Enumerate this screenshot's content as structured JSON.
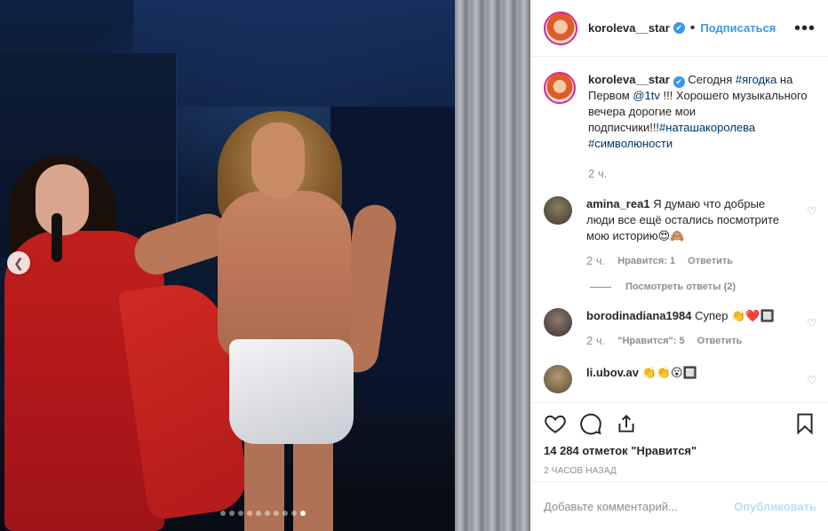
{
  "post": {
    "username": "koroleva__star",
    "follow_label": "Подписаться",
    "more_label": "•••"
  },
  "caption": {
    "username": "koroleva__star",
    "text_before": "Сегодня ",
    "tag1": "#ягодка",
    "text_mid1": " на Первом ",
    "tag2": "@1tv",
    "text_mid2": " !!! Хорошего музыкального вечера дорогие мои подписчики!!!",
    "tag3": "#наташакоролева",
    "tag4": "#символюности",
    "time": "2 ч."
  },
  "comments": [
    {
      "username": "amina_rea1",
      "text": "Я думаю что добрые люди все ещё остались посмотрите мою историю😍🙈",
      "time": "2 ч.",
      "likes": "Нравится: 1",
      "reply": "Ответить",
      "view_replies": "Посмотреть ответы (2)"
    },
    {
      "username": "borodinadiana1984",
      "text": "Супер 👏❤️🔲",
      "time": "2 ч.",
      "likes": "\"Нравится\": 5",
      "reply": "Ответить"
    },
    {
      "username": "li.ubov.av",
      "text": "👏👏😮🔲"
    }
  ],
  "stats": {
    "likes": "14 284 отметок \"Нравится\"",
    "ago": "2 ЧАСОВ НАЗАД"
  },
  "composer": {
    "placeholder": "Добавьте комментарий...",
    "publish": "Опубликовать"
  },
  "carousel": {
    "count": 10,
    "active_index": 9
  },
  "colors": {
    "link": "#3897f0",
    "hashtag": "#003569",
    "muted": "#8e8e8e",
    "publish_disabled": "#b2dffc"
  }
}
